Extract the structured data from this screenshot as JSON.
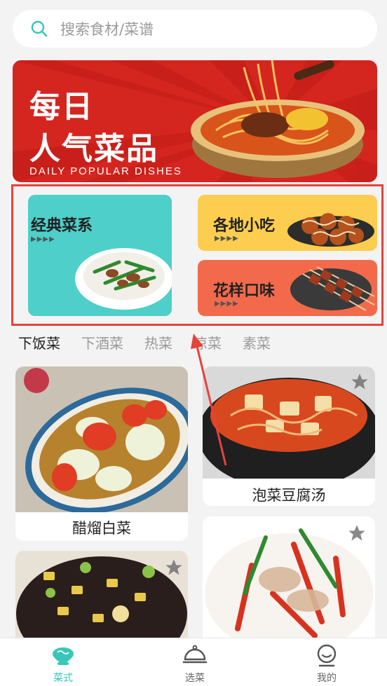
{
  "search": {
    "placeholder": "搜索食材/菜谱",
    "icon": "search-icon"
  },
  "banner": {
    "title_line1": "每日",
    "title_line2": "人气菜品",
    "subtitle": "DAILY POPULAR DISHES"
  },
  "categories": [
    {
      "label": "经典菜系",
      "dots": "▶▶▶▶",
      "color": "#4ecfc9"
    },
    {
      "label": "各地小吃",
      "dots": "▶▶▶▶",
      "color": "#fccd4f"
    },
    {
      "label": "花样口味",
      "dots": "▶▶▶▶",
      "color": "#f26a4b"
    }
  ],
  "tabs": [
    "下饭菜",
    "下酒菜",
    "热菜",
    "凉菜",
    "素菜"
  ],
  "active_tab": "下饭菜",
  "dishes": [
    {
      "name": "醋熘白菜"
    },
    {
      "name": "泡菜豆腐汤"
    },
    {
      "name": ""
    },
    {
      "name": ""
    }
  ],
  "tabbar": {
    "items": [
      {
        "label": "菜式",
        "icon": "bowl-icon"
      },
      {
        "label": "选菜",
        "icon": "cloche-icon"
      },
      {
        "label": "我的",
        "icon": "user-icon"
      }
    ],
    "active": "菜式",
    "accent": "#38c6b8"
  }
}
